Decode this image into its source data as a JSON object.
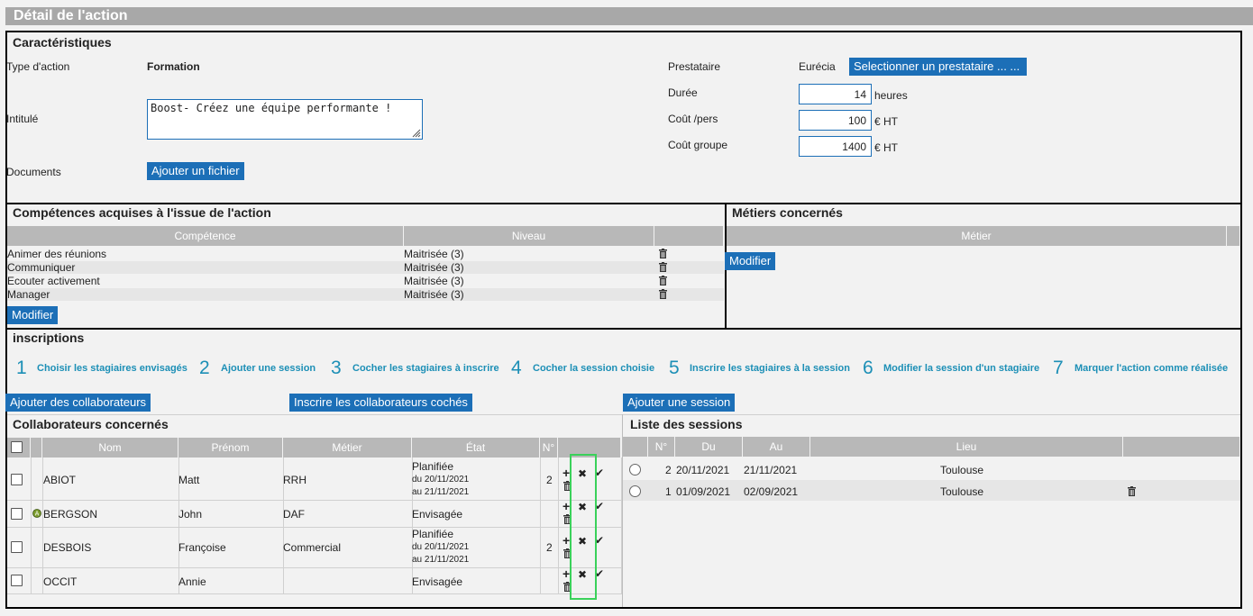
{
  "page": {
    "title": "Détail de l'action"
  },
  "caracteristiques": {
    "title": "Caractéristiques",
    "type_label": "Type d'action",
    "type_value": "Formation",
    "intitule_label": "Intitulé",
    "intitule_value": "Boost- Créez une équipe performante !",
    "documents_label": "Documents",
    "add_file_button": "Ajouter un fichier",
    "prestataire_label": "Prestataire",
    "prestataire_value": "Eurécia",
    "select_prestataire_button": "Selectionner un prestataire ... ...",
    "duree_label": "Durée",
    "duree_value": "14",
    "duree_unit": "heures",
    "cout_pers_label": "Coût /pers",
    "cout_pers_value": "100",
    "cout_pers_unit": "€ HT",
    "cout_groupe_label": "Coût groupe",
    "cout_groupe_value": "1400",
    "cout_groupe_unit": "€ HT"
  },
  "competences": {
    "title": "Compétences acquises à  l'issue de l'action",
    "headers": {
      "competence": "Compétence",
      "niveau": "Niveau"
    },
    "rows": [
      {
        "competence": "Animer des réunions",
        "niveau": "Maitrisée (3)"
      },
      {
        "competence": "Communiquer",
        "niveau": "Maitrisée (3)"
      },
      {
        "competence": "Ecouter activement",
        "niveau": "Maitrisée (3)"
      },
      {
        "competence": "Manager",
        "niveau": "Maitrisée (3)"
      }
    ],
    "modify_button": "Modifier"
  },
  "metiers": {
    "title": "Métiers concernés",
    "header": "Métier",
    "modify_button": "Modifier"
  },
  "inscriptions": {
    "title": "inscriptions",
    "steps": [
      {
        "num": "1",
        "label": "Choisir les stagiaires envisagés"
      },
      {
        "num": "2",
        "label": "Ajouter une session"
      },
      {
        "num": "3",
        "label": "Cocher les stagiaires à inscrire"
      },
      {
        "num": "4",
        "label": "Cocher la session choisie"
      },
      {
        "num": "5",
        "label": "Inscrire les stagiaires à la session"
      },
      {
        "num": "6",
        "label": "Modifier la session d'un stagiaire"
      },
      {
        "num": "7",
        "label": "Marquer l'action comme réalisée"
      }
    ],
    "add_collab_button": "Ajouter des collaborateurs",
    "inscrire_button": "Inscrire les collaborateurs cochés",
    "add_session_button": "Ajouter une session"
  },
  "collaborateurs": {
    "title": "Collaborateurs concernés",
    "headers": {
      "nom": "Nom",
      "prenom": "Prénom",
      "metier": "Métier",
      "etat": "État",
      "num": "N°"
    },
    "rows": [
      {
        "nom": "ABIOT",
        "prenom": "Matt",
        "metier": "RRH",
        "etat": "Planifiée",
        "du": "du 20/11/2021",
        "au": "au 21/11/2021",
        "num": "2",
        "badge": ""
      },
      {
        "nom": "BERGSON",
        "prenom": "John",
        "metier": "DAF",
        "etat": "Envisagée",
        "du": "",
        "au": "",
        "num": "",
        "badge": "A"
      },
      {
        "nom": "DESBOIS",
        "prenom": "Françoise",
        "metier": "Commercial",
        "etat": "Planifiée",
        "du": "du 20/11/2021",
        "au": "au 21/11/2021",
        "num": "2",
        "badge": ""
      },
      {
        "nom": "OCCIT",
        "prenom": "Annie",
        "metier": "",
        "etat": "Envisagée",
        "du": "",
        "au": "",
        "num": "",
        "badge": ""
      }
    ]
  },
  "sessions": {
    "title": "Liste des sessions",
    "headers": {
      "num": "N°",
      "du": "Du",
      "au": "Au",
      "lieu": "Lieu"
    },
    "rows": [
      {
        "num": "2",
        "du": "20/11/2021",
        "au": "21/11/2021",
        "lieu": "Toulouse"
      },
      {
        "num": "1",
        "du": "01/09/2021",
        "au": "02/09/2021",
        "lieu": "Toulouse"
      }
    ]
  },
  "icons": {
    "plus": "+",
    "cross": "✖",
    "check": "✔"
  },
  "colors": {
    "accent": "#1c6fb7",
    "step": "#1c8fb6",
    "highlight": "#3ad15a",
    "header": "#b8b8b8"
  }
}
